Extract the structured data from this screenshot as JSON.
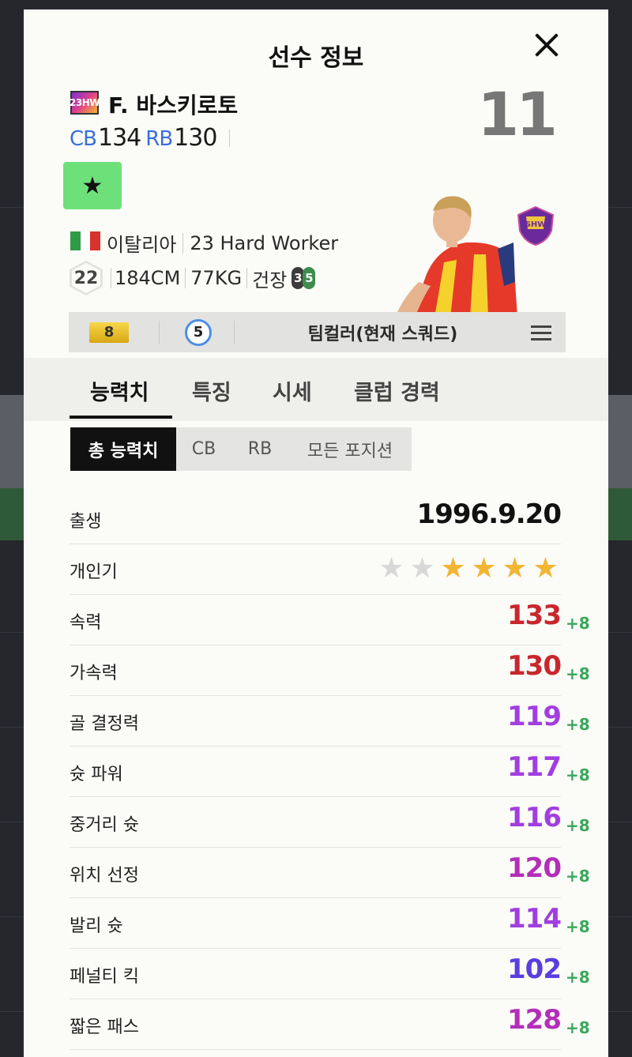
{
  "modal": {
    "title": "선수 정보"
  },
  "player": {
    "season_badge": "23HW",
    "name": "F. 바스키로토",
    "positions": [
      {
        "label": "CB",
        "value": "134"
      },
      {
        "label": "RB",
        "value": "130"
      }
    ],
    "jersey_number": "11",
    "nation": "이탈리아",
    "season_name": "23 Hard Worker",
    "age": "22",
    "height": "184CM",
    "weight": "77KG",
    "body_type": "건장",
    "weak_foot_left": "3",
    "weak_foot_right": "5",
    "club_logo_text": "SHW"
  },
  "info_bar": {
    "grade": "8",
    "level": "5",
    "team_color": "팀컬러(현재 스쿼드)"
  },
  "tabs": [
    {
      "label": "능력치",
      "active": true
    },
    {
      "label": "특징",
      "active": false
    },
    {
      "label": "시세",
      "active": false
    },
    {
      "label": "클럽 경력",
      "active": false
    }
  ],
  "sub_tabs": [
    {
      "label": "총 능력치",
      "active": true
    },
    {
      "label": "CB",
      "active": false
    },
    {
      "label": "RB",
      "active": false
    },
    {
      "label": "모든 포지션",
      "active": false
    }
  ],
  "birth": {
    "label": "출생",
    "value": "1996.9.20"
  },
  "popularity": {
    "label": "개인기",
    "stars_filled": 4,
    "stars_total": 6
  },
  "stats": [
    {
      "label": "속력",
      "value": "133",
      "bonus": "+8",
      "color": "#c8272d"
    },
    {
      "label": "가속력",
      "value": "130",
      "bonus": "+8",
      "color": "#c8272d"
    },
    {
      "label": "골 결정력",
      "value": "119",
      "bonus": "+8",
      "color": "#a23ee0"
    },
    {
      "label": "슛 파워",
      "value": "117",
      "bonus": "+8",
      "color": "#a23ee0"
    },
    {
      "label": "중거리 슛",
      "value": "116",
      "bonus": "+8",
      "color": "#a23ee0"
    },
    {
      "label": "위치 선정",
      "value": "120",
      "bonus": "+8",
      "color": "#b32fb8"
    },
    {
      "label": "발리 슛",
      "value": "114",
      "bonus": "+8",
      "color": "#a23ee0"
    },
    {
      "label": "페널티 킥",
      "value": "102",
      "bonus": "+8",
      "color": "#5a3ee0"
    },
    {
      "label": "짧은 패스",
      "value": "128",
      "bonus": "+8",
      "color": "#b32fb8"
    }
  ],
  "colors": {
    "position_label": "#3a6fd8",
    "bonus": "#3aa85a",
    "star_filled": "#f2b633",
    "star_empty": "#d8d8d8",
    "star_box": "#6ee07a"
  }
}
